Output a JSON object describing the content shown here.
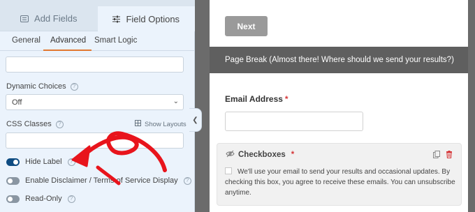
{
  "top_tabs": [
    {
      "label": "Add Fields",
      "icon": "list-icon"
    },
    {
      "label": "Field Options",
      "icon": "sliders-icon"
    }
  ],
  "sub_tabs": [
    "General",
    "Advanced",
    "Smart Logic"
  ],
  "fields": {
    "dynamic_choices": {
      "label": "Dynamic Choices",
      "value": "Off"
    },
    "css_classes": {
      "label": "CSS Classes",
      "show_layouts": "Show Layouts"
    }
  },
  "toggles": [
    {
      "label": "Hide Label",
      "on": true
    },
    {
      "label": "Enable Disclaimer / Terms of Service Display",
      "on": false
    },
    {
      "label": "Read-Only",
      "on": false
    }
  ],
  "preview": {
    "next_button": "Next",
    "page_break": "Page Break (Almost there! Where should we send your results?)",
    "email_label": "Email Address",
    "required_marker": "*",
    "checkboxes_label": "Checkboxes",
    "checkbox_text": "We'll use your email to send your results and occasional updates. By checking this box, you agree to receive these emails. You can unsubscribe anytime."
  },
  "colors": {
    "accent": "#e27730",
    "toggle_on": "#0e4c82",
    "annotation_arrow": "#e8141c",
    "required": "#d63638"
  }
}
